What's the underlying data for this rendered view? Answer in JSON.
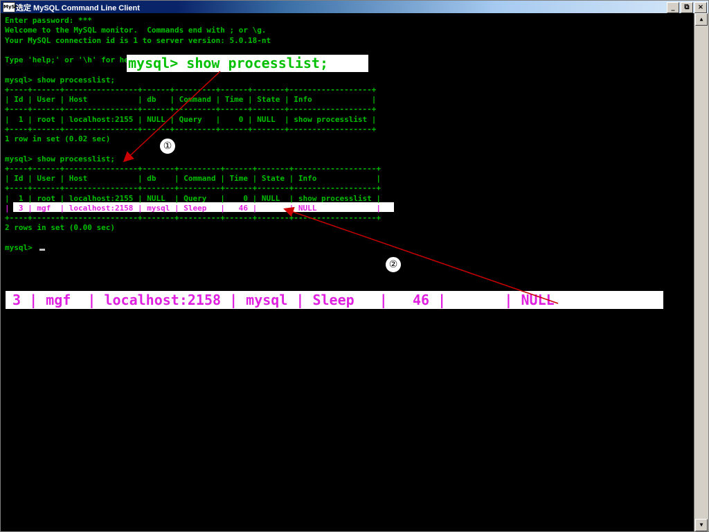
{
  "window": {
    "title": "选定 MySQL Command Line Client",
    "icon_label": "MySQL",
    "buttons": {
      "minimize": "_",
      "restore": "⧉",
      "close": "×"
    }
  },
  "console": {
    "lines": [
      "Enter password: ***",
      "Welcome to the MySQL monitor.  Commands end with ; or \\g.",
      "Your MySQL connection id is 1 to server version: 5.0.18-nt",
      "",
      "Type 'help;' or '\\h' for help. Type '\\c' to clear the buffer.",
      "",
      "mysql> show processlist;",
      "+----+------+----------------+------+---------+------+-------+------------------+",
      "| Id | User | Host           | db   | Command | Time | State | Info             |",
      "+----+------+----------------+------+---------+------+-------+------------------+",
      "|  1 | root | localhost:2155 | NULL | Query   |    0 | NULL  | show processlist |",
      "+----+------+----------------+------+---------+------+-------+------------------+",
      "1 row in set (0.02 sec)",
      "",
      "mysql> show processlist;",
      "+----+------+----------------+-------+---------+------+-------+------------------+",
      "| Id | User | Host           | db    | Command | Time | State | Info             |",
      "+----+------+----------------+-------+---------+------+-------+------------------+",
      "|  1 | root | localhost:2155 | NULL  | Query   |    0 | NULL  | show processlist |",
      "|  3 | mgf  | localhost:2158 | mysql | Sleep   |   46 |       | NULL             |",
      "+----+------+----------------+-------+---------+------+-------+------------------+",
      "2 rows in set (0.00 sec)",
      "",
      "mysql> "
    ]
  },
  "annotations": {
    "callout1": "mysql> show processlist;",
    "callout2": "3 | mgf  | localhost:2158 | mysql | Sleep   |   46 |       | NULL",
    "marker1": "①",
    "marker2": "②",
    "arrow_color": "#cc0000"
  },
  "colors": {
    "console_text": "#00c000",
    "highlight_text": "#e020e0",
    "highlight_bg": "#ffffff"
  }
}
